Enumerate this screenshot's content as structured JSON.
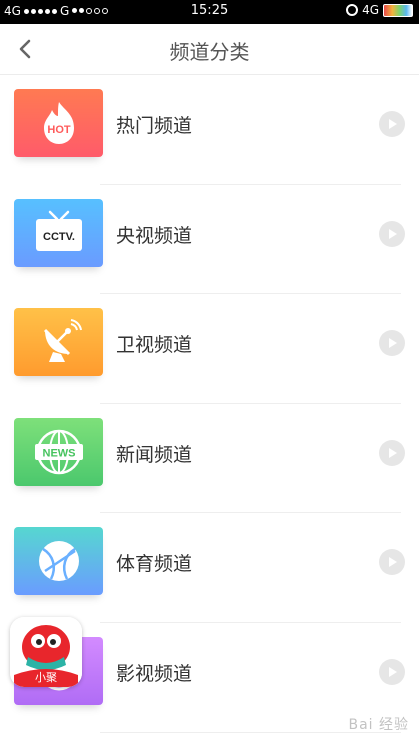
{
  "status_bar": {
    "carrier_left": "4G",
    "carrier_mid": "G",
    "time": "15:25",
    "network_right": "4G"
  },
  "header": {
    "title": "频道分类",
    "back_icon": "chevron-left-icon"
  },
  "categories": [
    {
      "label": "热门频道",
      "icon": "hot-flame-icon",
      "icon_text": "HOT",
      "color_top": "#ff7a52",
      "color_bottom": "#ff5b6a"
    },
    {
      "label": "央视频道",
      "icon": "tv-icon",
      "icon_text": "CCTV.",
      "color_top": "#57c0ff",
      "color_bottom": "#6a9bff"
    },
    {
      "label": "卫视频道",
      "icon": "satellite-dish-icon",
      "icon_text": "",
      "color_top": "#ffc148",
      "color_bottom": "#ff9b2e"
    },
    {
      "label": "新闻频道",
      "icon": "news-globe-icon",
      "icon_text": "NEWS",
      "color_top": "#7ee07a",
      "color_bottom": "#4bc86d"
    },
    {
      "label": "体育频道",
      "icon": "basketball-icon",
      "icon_text": "",
      "color_top": "#56d7d0",
      "color_bottom": "#6a9cff"
    },
    {
      "label": "影视频道",
      "icon": "movie-icon",
      "icon_text": "",
      "color_top": "#d38bff",
      "color_bottom": "#b06cf5"
    }
  ],
  "badge": {
    "label": "小聚",
    "icon": "mascot-icon"
  },
  "watermark": "Bai 经验"
}
